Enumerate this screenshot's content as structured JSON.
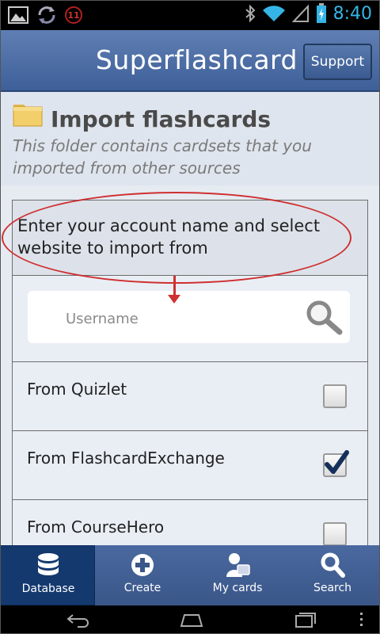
{
  "status_bar": {
    "notification_count": "11",
    "time": "8:40",
    "icons": [
      "image-icon",
      "sync-icon",
      "notification-badge",
      "bluetooth-icon",
      "wifi-icon",
      "signal-icon",
      "battery-icon"
    ]
  },
  "header": {
    "title": "Superflashcard",
    "support_label": "Support"
  },
  "folder": {
    "title": "Import flashcards",
    "description": "This folder contains cardsets that you imported from other sources"
  },
  "import": {
    "instruction": "Enter your account name and select website to import from",
    "username_placeholder": "Username",
    "options": [
      {
        "label": "From Quizlet",
        "checked": false
      },
      {
        "label": "From FlashcardExchange",
        "checked": true
      },
      {
        "label": "From CourseHero",
        "checked": false
      }
    ]
  },
  "tabs": [
    {
      "label": "Database",
      "icon": "database-icon",
      "active": true
    },
    {
      "label": "Create",
      "icon": "plus-circle-icon",
      "active": false
    },
    {
      "label": "My cards",
      "icon": "user-cards-icon",
      "active": false
    },
    {
      "label": "Search",
      "icon": "search-icon",
      "active": false
    }
  ],
  "colors": {
    "accent": "#35b5e5",
    "header": "#4a6aa2",
    "annotation": "#cf3030",
    "active_tab": "#14396f"
  }
}
